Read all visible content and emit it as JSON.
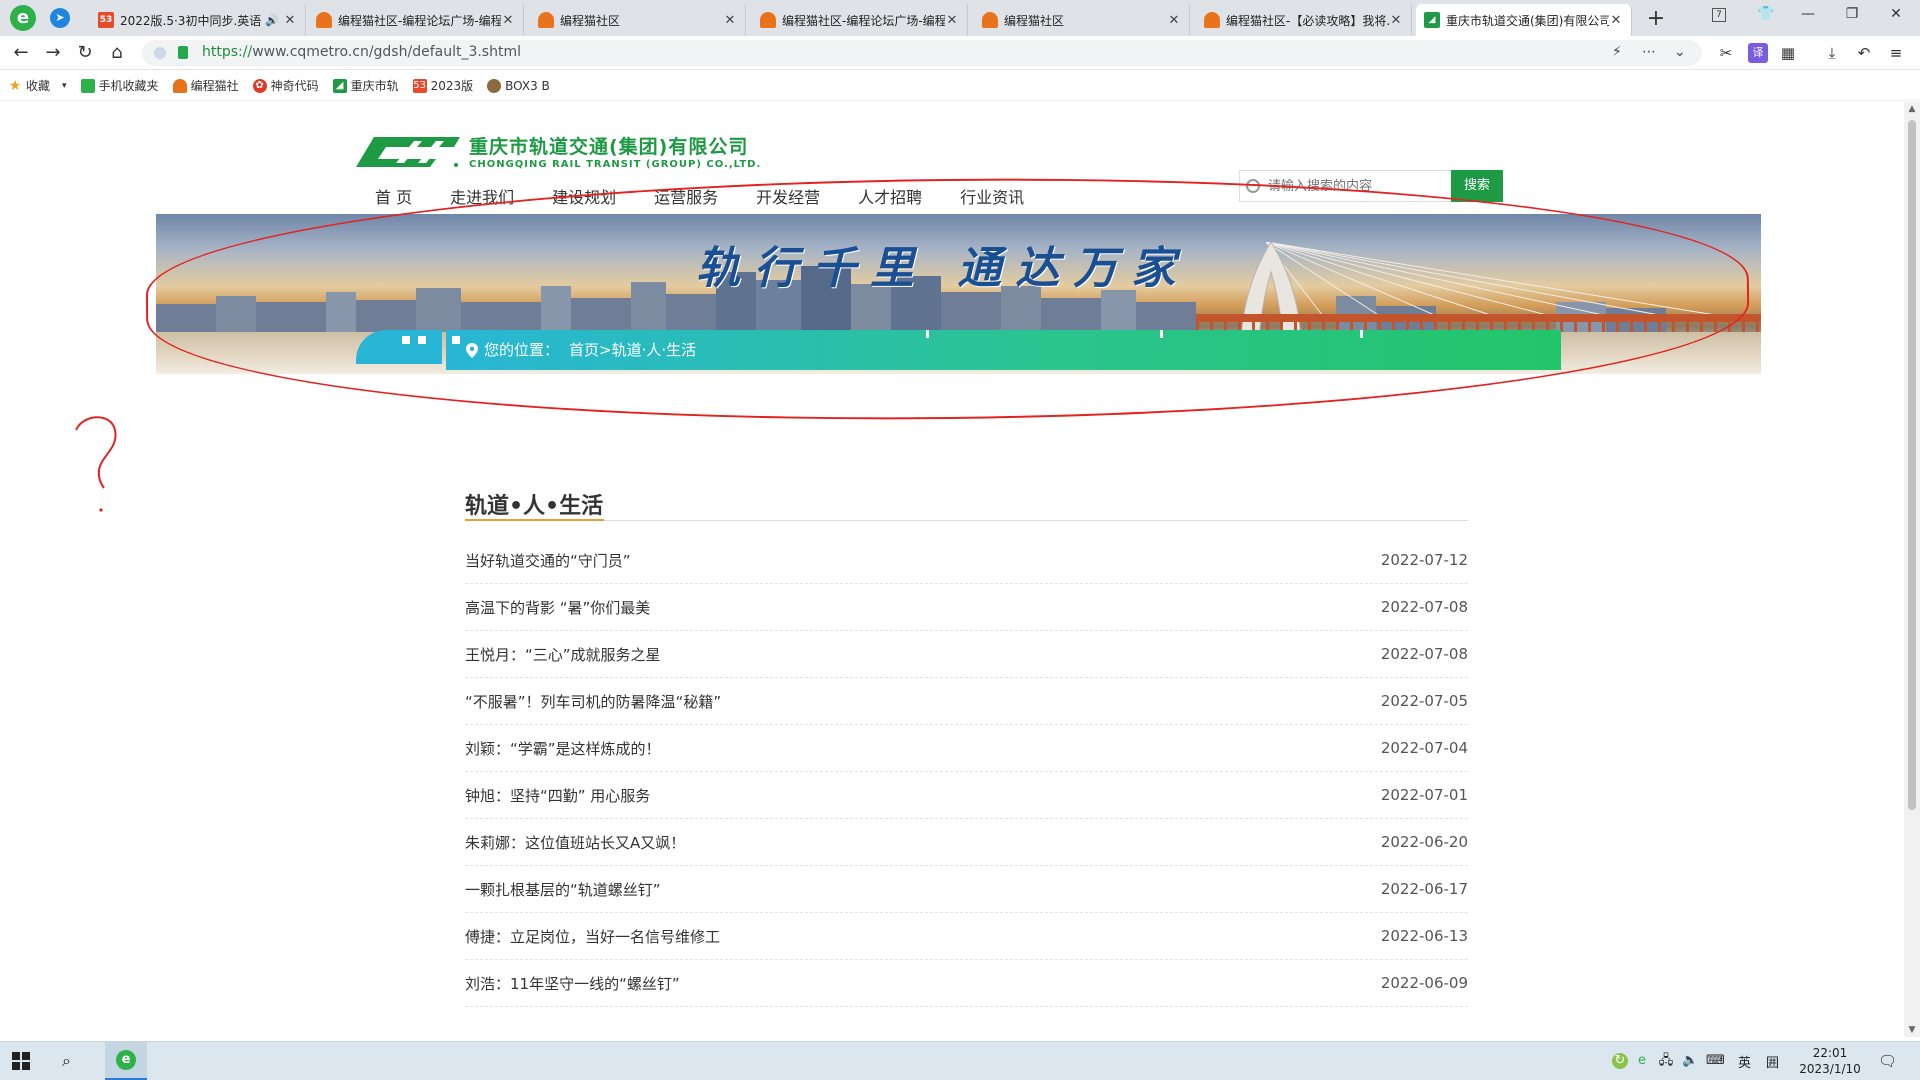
{
  "browser": {
    "tabs": [
      {
        "title": "2022版.5·3初中同步.英语...",
        "favicon": "53",
        "audio": true,
        "active": false
      },
      {
        "title": "编程猫社区-编程论坛广场-编程...",
        "favicon": "cat",
        "audio": false,
        "active": false
      },
      {
        "title": "编程猫社区",
        "favicon": "cat",
        "audio": false,
        "active": false
      },
      {
        "title": "编程猫社区-编程论坛广场-编程...",
        "favicon": "cat",
        "audio": false,
        "active": false
      },
      {
        "title": "编程猫社区",
        "favicon": "cat",
        "audio": false,
        "active": false
      },
      {
        "title": "编程猫社区-【必读攻略】我将...",
        "favicon": "cat",
        "audio": false,
        "active": false
      },
      {
        "title": "重庆市轨道交通(集团)有限公司...",
        "favicon": "metro",
        "audio": false,
        "active": true
      }
    ],
    "tab_count_badge": "7",
    "url_proto": "https://",
    "url_rest": "www.cqmetro.cn/gdsh/default_3.shtml",
    "bookmarks": [
      {
        "label": "收藏",
        "icon": "star-icon"
      },
      {
        "label": "手机收藏夹",
        "icon": "phone-icon"
      },
      {
        "label": "编程猫社",
        "icon": "cat-icon"
      },
      {
        "label": "神奇代码",
        "icon": "gear-icon"
      },
      {
        "label": "重庆市轨",
        "icon": "metro-icon"
      },
      {
        "label": "2023版",
        "icon": "fifty-three-icon"
      },
      {
        "label": "BOX3 B",
        "icon": "box-icon"
      }
    ]
  },
  "site": {
    "logo_cn": "重庆市轨道交通(集团)有限公司",
    "logo_en": "CHONGQING RAIL TRANSIT (GROUP) CO.,LTD.",
    "nav": [
      "首 页",
      "走进我们",
      "建设规划",
      "运营服务",
      "开发经营",
      "人才招聘",
      "行业资讯"
    ],
    "active_nav": 0,
    "search_placeholder": "请输入搜索的内容",
    "search_button": "搜索",
    "banner_slogan": "轨行千里   通达万家",
    "breadcrumb": {
      "prefix": "您的位置：",
      "home": "首页",
      "sep": " > ",
      "current": "轨道·人·生活"
    },
    "section_title": "轨道•人•生活",
    "articles": [
      {
        "title": "当好轨道交通的“守门员”",
        "date": "2022-07-12"
      },
      {
        "title": "高温下的背影 “暑”你们最美",
        "date": "2022-07-08"
      },
      {
        "title": "王悦月：“三心”成就服务之星",
        "date": "2022-07-08"
      },
      {
        "title": "“不服暑”！列车司机的防暑降温“秘籍”",
        "date": "2022-07-05"
      },
      {
        "title": "刘颖：“学霸”是这样炼成的！",
        "date": "2022-07-04"
      },
      {
        "title": "钟旭：坚持“四勤” 用心服务",
        "date": "2022-07-01"
      },
      {
        "title": "朱莉娜：这位值班站长又A又飒！",
        "date": "2022-06-20"
      },
      {
        "title": "一颗扎根基层的“轨道螺丝钉”",
        "date": "2022-06-17"
      },
      {
        "title": "傅捷：立足岗位，当好一名信号维修工",
        "date": "2022-06-13"
      },
      {
        "title": "刘浩：11年坚守一线的“螺丝钉”",
        "date": "2022-06-09"
      }
    ]
  },
  "taskbar": {
    "ime": "英",
    "ime_mode": "囲",
    "time": "22:01",
    "date": "2023/1/10"
  },
  "colors": {
    "brand_green": "#1e9a45",
    "annotation_red": "#e32222",
    "accent_orange": "#e2a23a"
  }
}
